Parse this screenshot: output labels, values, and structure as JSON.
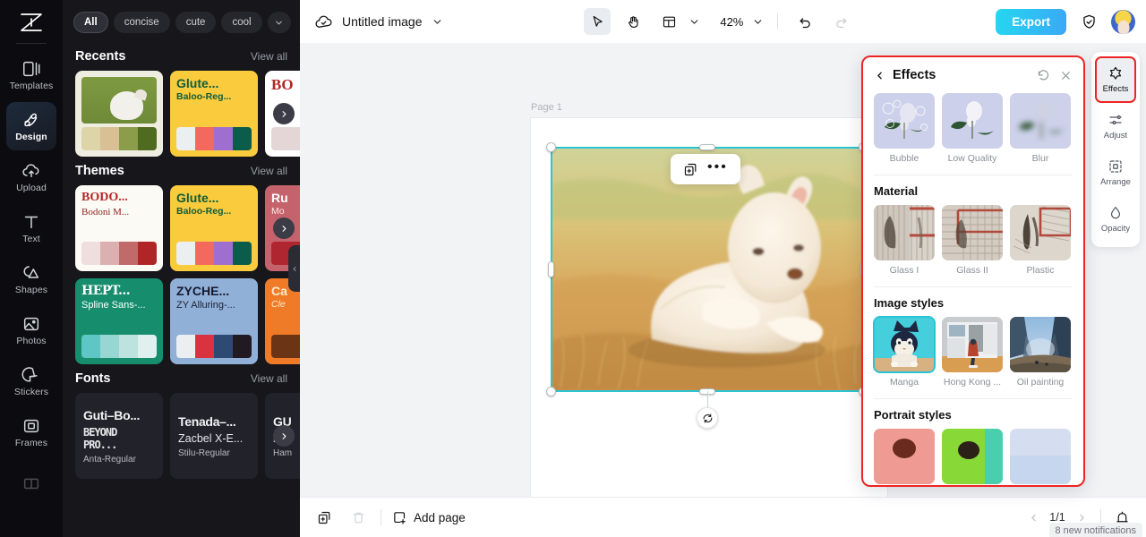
{
  "rail": {
    "logo_icon": "app-logo-icon",
    "items": [
      {
        "label": "Templates",
        "icon": "templates-icon",
        "active": false
      },
      {
        "label": "Design",
        "icon": "design-icon",
        "active": true
      },
      {
        "label": "Upload",
        "icon": "upload-icon",
        "active": false
      },
      {
        "label": "Text",
        "icon": "text-icon",
        "active": false
      },
      {
        "label": "Shapes",
        "icon": "shapes-icon",
        "active": false
      },
      {
        "label": "Photos",
        "icon": "photos-icon",
        "active": false
      },
      {
        "label": "Stickers",
        "icon": "stickers-icon",
        "active": false
      },
      {
        "label": "Frames",
        "icon": "frames-icon",
        "active": false
      }
    ]
  },
  "panel": {
    "chips": [
      {
        "label": "All",
        "active": true
      },
      {
        "label": "concise",
        "active": false
      },
      {
        "label": "cute",
        "active": false
      },
      {
        "label": "cool",
        "active": false
      }
    ],
    "chips_more_icon": "chevron-down-icon",
    "collapse_icon": "chevron-left-icon",
    "next_arrow_icon": "chevron-right-icon",
    "sections": [
      {
        "title": "Recents",
        "view_all": "View all",
        "cards": [
          {
            "kind": "photo",
            "bg": "#efece0",
            "swatches": [
              "#ddd4a8",
              "#d9bf94",
              "#8b9c4a",
              "#4e6b1f"
            ]
          },
          {
            "kind": "text",
            "bg": "#fbcb3e",
            "line1": "Glute...",
            "line2": "Baloo-Reg...",
            "color1": "#0d5c3a",
            "color2": "#0d5c3a",
            "swatches": [
              "#eceff1",
              "#f4695d",
              "#9e6fd0",
              "#0b5c4a"
            ]
          },
          {
            "kind": "text",
            "bg": "#ffffff",
            "line1": "BO",
            "line2": "",
            "color1": "#b42626",
            "color2": "#b42626",
            "swatches": [
              "#e4d6d6"
            ]
          }
        ]
      },
      {
        "title": "Themes",
        "view_all": "View all",
        "cards": [
          {
            "kind": "text",
            "bg": "#fcfaf4",
            "line1": "BODO...",
            "line2": "Bodoni M...",
            "color1": "#b42626",
            "color2": "#8f2222",
            "swatches": [
              "#f0dede",
              "#dbb0b0",
              "#c06a6a",
              "#b02626"
            ]
          },
          {
            "kind": "text",
            "bg": "#fbcb3e",
            "line1": "Glute...",
            "line2": "Baloo-Reg...",
            "color1": "#0d5c3a",
            "color2": "#0d5c3a",
            "swatches": [
              "#eceff1",
              "#f4695d",
              "#9e6fd0",
              "#0b5c4a"
            ]
          },
          {
            "kind": "text",
            "bg": "#c4636b",
            "line1": "Ru",
            "line2": "Mo",
            "color1": "#ffffff",
            "color2": "#ffe8e8",
            "swatches": [
              "#b02630"
            ]
          }
        ]
      },
      {
        "title": "",
        "view_all": "",
        "cards": [
          {
            "kind": "text",
            "bg": "#168e6e",
            "line1": "HEPT...",
            "line2": "Spline Sans-...",
            "color1": "#ffffff",
            "color2": "#ffffff",
            "swatches": [
              "#5fc6c6",
              "#97d6d3",
              "#bee2de",
              "#dff0ee"
            ]
          },
          {
            "kind": "text",
            "bg": "#91b0d8",
            "line1": "ZYCHE...",
            "line2": "ZY Alluring-...",
            "color1": "#151a2e",
            "color2": "#1b2236",
            "swatches": [
              "#eceff1",
              "#d9333f",
              "#2d4a74",
              "#211a22"
            ]
          },
          {
            "kind": "text",
            "bg": "#ef7b28",
            "line1": "Ca",
            "line2": "Cle",
            "color1": "#ffe9c9",
            "color2": "#ffe9c9",
            "swatches": [
              "#6b3414"
            ]
          }
        ]
      },
      {
        "title": "Fonts",
        "view_all": "View all",
        "cards": [
          {
            "kind": "font",
            "l1": "Guti–Bo...",
            "l2": "BEYOND PRO...",
            "l3": "Anta-Regular"
          },
          {
            "kind": "font",
            "l1": "Tenada–...",
            "l2": "Zacbel X-E...",
            "l3": "Stilu-Regular"
          },
          {
            "kind": "font",
            "l1": "GU",
            "l2": "D",
            "l3": "Ham"
          }
        ]
      }
    ]
  },
  "topbar": {
    "cloud_icon": "cloud-saved-icon",
    "title": "Untitled image",
    "title_caret_icon": "chevron-down-icon",
    "tools": [
      {
        "name": "select-tool",
        "icon": "cursor-icon",
        "selected": true
      },
      {
        "name": "hand-tool",
        "icon": "hand-icon",
        "selected": false
      },
      {
        "name": "layout-tool",
        "icon": "layout-icon",
        "selected": false
      }
    ],
    "layout_caret_icon": "chevron-down-icon",
    "zoom": "42%",
    "zoom_caret_icon": "chevron-down-icon",
    "undo_icon": "undo-icon",
    "redo_icon": "redo-icon",
    "export_label": "Export",
    "shield_icon": "shield-check-icon",
    "avatar_name": "user-avatar"
  },
  "canvas": {
    "page_label": "Page 1",
    "float_toolbar": {
      "duplicate_icon": "duplicate-icon",
      "more_icon": "more-horizontal-icon"
    },
    "rotate_icon": "rotate-icon",
    "selection_color": "#2bc4d4"
  },
  "bottombar": {
    "duplicate_icon": "duplicate-page-icon",
    "delete_icon": "trash-icon",
    "add_page_icon": "add-page-icon",
    "add_page_label": "Add page",
    "prev_icon": "chevron-left-icon",
    "next_icon": "chevron-right-icon",
    "page_indicator": "1/1",
    "notifications_icon": "notifications-icon",
    "notifications_tooltip": "8 new notifications"
  },
  "effects_panel": {
    "back_icon": "chevron-left-icon",
    "title": "Effects",
    "reset_icon": "reset-icon",
    "close_icon": "close-icon",
    "groups": [
      {
        "title": "",
        "items": [
          {
            "label": "Bubble",
            "selected": false,
            "thumb": "rose-bubble"
          },
          {
            "label": "Low Quality",
            "selected": false,
            "thumb": "rose-plain"
          },
          {
            "label": "Blur",
            "selected": false,
            "thumb": "rose-blur"
          }
        ]
      },
      {
        "title": "Material",
        "items": [
          {
            "label": "Glass I",
            "selected": false,
            "thumb": "glass-one"
          },
          {
            "label": "Glass II",
            "selected": false,
            "thumb": "glass-two"
          },
          {
            "label": "Plastic",
            "selected": false,
            "thumb": "plastic"
          }
        ]
      },
      {
        "title": "Image styles",
        "items": [
          {
            "label": "Manga",
            "selected": true,
            "thumb": "manga-cat"
          },
          {
            "label": "Hong Kong ...",
            "selected": false,
            "thumb": "hongkong"
          },
          {
            "label": "Oil painting",
            "selected": false,
            "thumb": "oil-painting"
          }
        ]
      },
      {
        "title": "Portrait styles",
        "items": [
          {
            "label": "",
            "selected": false,
            "thumb": "portrait-pink"
          },
          {
            "label": "",
            "selected": false,
            "thumb": "portrait-green"
          },
          {
            "label": "",
            "selected": false,
            "thumb": "portrait-blue"
          }
        ]
      }
    ]
  },
  "right_toolbar": {
    "items": [
      {
        "label": "Effects",
        "icon": "sparkle-icon",
        "selected": true
      },
      {
        "label": "Adjust",
        "icon": "sliders-icon",
        "selected": false
      },
      {
        "label": "Arrange",
        "icon": "arrange-icon",
        "selected": false
      },
      {
        "label": "Opacity",
        "icon": "opacity-icon",
        "selected": false
      }
    ]
  }
}
